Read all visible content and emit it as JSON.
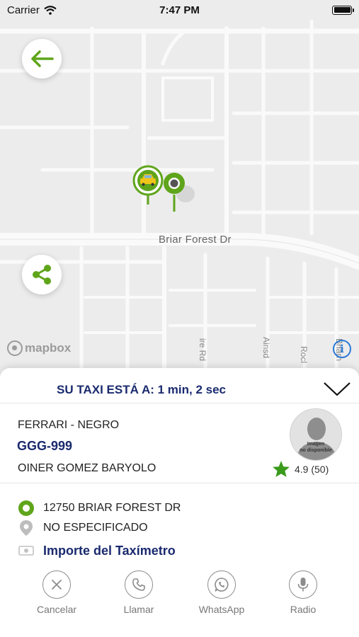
{
  "status_bar": {
    "carrier": "Carrier",
    "time": "7:47 PM"
  },
  "map": {
    "street_label": "Briar Forest Dr",
    "vertical_labels": [
      "ire Rd",
      "Ainsd",
      "Rocl",
      "Briarh"
    ],
    "attribution": "mapbox",
    "info_glyph": "i"
  },
  "eta": {
    "label": "SU TAXI ESTÁ A: 1 min, 2 sec"
  },
  "driver": {
    "car": "FERRARI - NEGRO",
    "plate": "GGG-999",
    "name": "OINER GOMEZ BARYOLO",
    "avatar_caption_1": "Imagen",
    "avatar_caption_2": "no disponible",
    "rating": "4.9 (50)"
  },
  "trip": {
    "pickup": "12750 BRIAR FOREST DR",
    "destination": "NO ESPECIFICADO",
    "fare": "Importe del Taxímetro"
  },
  "actions": [
    {
      "label": "Cancelar",
      "icon": "close-icon"
    },
    {
      "label": "Llamar",
      "icon": "phone-icon"
    },
    {
      "label": "WhatsApp",
      "icon": "whatsapp-icon"
    },
    {
      "label": "Radio",
      "icon": "microphone-icon"
    }
  ],
  "colors": {
    "accent_green": "#5fa51b",
    "navy": "#1a2a6e",
    "map_bg": "#ececec",
    "street": "#ffffff"
  }
}
